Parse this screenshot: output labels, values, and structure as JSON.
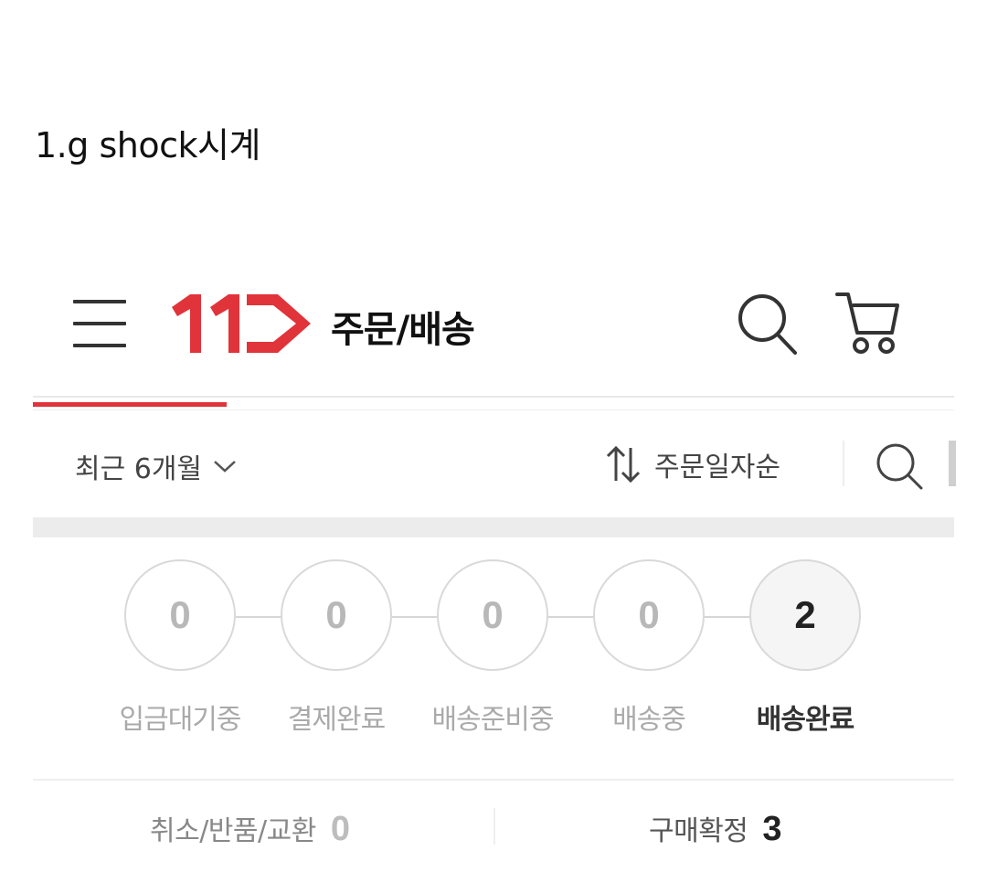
{
  "post": {
    "title": "1.g shock시계"
  },
  "header": {
    "logo_text": "11",
    "title": "주문/배송",
    "brand_color": "#e1333a",
    "icons": [
      "menu-icon",
      "search-icon",
      "cart-icon"
    ]
  },
  "filter": {
    "period_label": "최근 6개월",
    "period_icon": "chevron-down-icon",
    "sort_label": "주문일자순",
    "sort_icon": "sort-icon",
    "search_icon": "search-icon"
  },
  "steps": [
    {
      "label": "입금대기중",
      "count": "0",
      "active": false
    },
    {
      "label": "결제완료",
      "count": "0",
      "active": false
    },
    {
      "label": "배송준비중",
      "count": "0",
      "active": false
    },
    {
      "label": "배송중",
      "count": "0",
      "active": false
    },
    {
      "label": "배송완료",
      "count": "2",
      "active": true
    }
  ],
  "summary": {
    "cancel_label": "취소/반품/교환",
    "cancel_count": "0",
    "confirm_label": "구매확정",
    "confirm_count": "3"
  }
}
